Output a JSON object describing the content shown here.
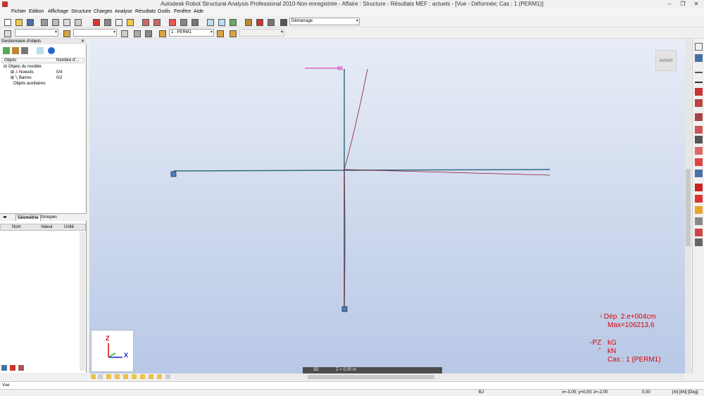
{
  "window": {
    "title": "Autodesk Robot Structural Analysis Professional 2010-Non enregistrée - Affaire : Structure - Résultats MEF : actuels - [Vue - Déformée; Cas : 1 (PERM1)]",
    "minimize": "–",
    "restore": "❐",
    "close": "✕"
  },
  "menu": [
    "Fichier",
    "Edition",
    "Affichage",
    "Structure",
    "Charges",
    "Analyse",
    "Résultats",
    "Outils",
    "Fenêtre",
    "Aide"
  ],
  "toolbar": {
    "layout_select": "Démarrage",
    "case_select": "1 : PERM1"
  },
  "object_manager": {
    "title": "Gestionnaire d'objets",
    "col_objects": "Objets",
    "col_count": "Nombre d'...",
    "tree": [
      {
        "label": "Objets du modèle",
        "count": ""
      },
      {
        "label": "Noeuds",
        "count": "0/4"
      },
      {
        "label": "Barres",
        "count": "0/2"
      },
      {
        "label": "Objets auxiliaires",
        "count": ""
      }
    ],
    "tabs": [
      "Géométrie",
      "Groupes"
    ],
    "props_cols": [
      "Nom",
      "Valeur",
      "Unité"
    ]
  },
  "viewport": {
    "view_cube_label": "AVANT",
    "axis_z": "Z",
    "axis_x": "X",
    "mode": "3D",
    "z_level": "Z = 0,00 m"
  },
  "legend": {
    "disp_label": "Dép",
    "disp_scale": "2.e+004cm",
    "max": "Max=106213,6",
    "force_dir": "-PZ",
    "unit1": "kG",
    "unit2": "kN",
    "case": "Cas : 1 (PERM1)"
  },
  "cmdline": {
    "text": "Vue"
  },
  "status": {
    "code": "BJ",
    "coords": "x=-3,00; y=0,00; z=-2,00",
    "value": "0,00",
    "units": "[m] [kN] [Deg]"
  },
  "colors": {
    "viewport_top": "#e8edf6",
    "viewport_bottom": "#b8c8e6",
    "structure": "#2e6c7e",
    "deformed": "#8b1a2a",
    "legend": "#e00000",
    "load": "#e020c0"
  }
}
